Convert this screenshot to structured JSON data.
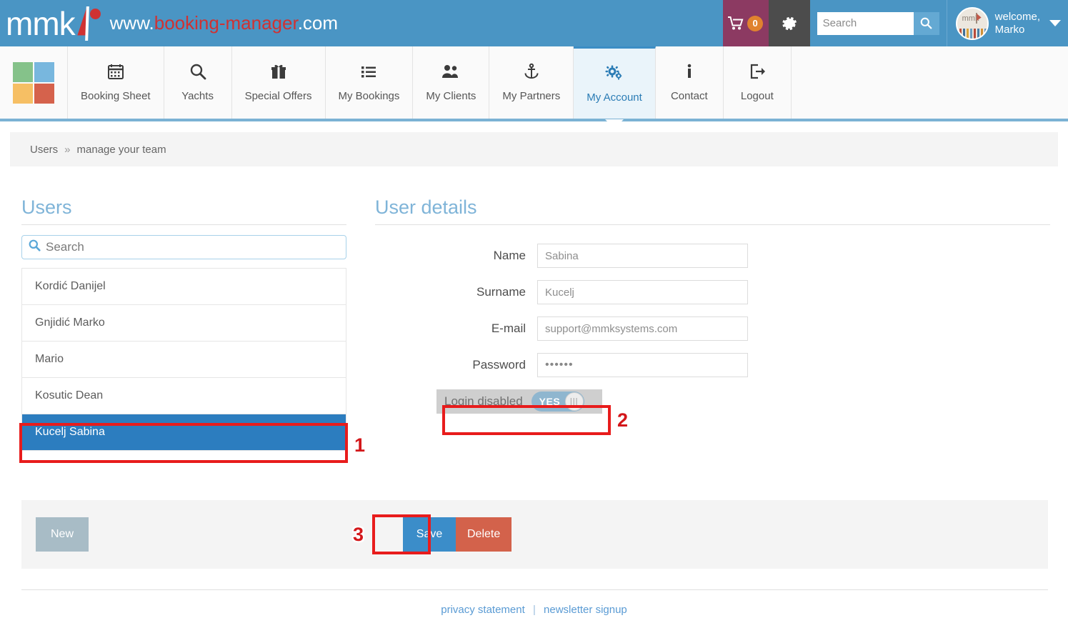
{
  "header": {
    "logo_text": "mmk",
    "site_url_prefix": "www.",
    "site_url_brand": "booking-manager",
    "site_url_suffix": ".com",
    "cart_icon": "shopping-cart-icon",
    "cart_count": "0",
    "gear_icon": "gear-icon",
    "search": {
      "placeholder": "Search",
      "value": "",
      "button_icon": "search-icon"
    },
    "avatar_label": "mmk",
    "welcome_line1": "welcome,",
    "welcome_line2": "Marko",
    "dropdown_icon": "chevron-down-icon",
    "colors": {
      "bar": "#4a95c4",
      "cart": "#8c3a62",
      "badge": "#e0822f",
      "gear": "#4c4c4c",
      "brand_red": "#cf3233"
    }
  },
  "nav": {
    "logo_squares": [
      "#85c28a",
      "#78b7de",
      "#f6bf64",
      "#d5624c"
    ],
    "items": [
      {
        "label": "Booking Sheet",
        "icon": "calendar-icon",
        "glyph": "☷",
        "active": false
      },
      {
        "label": "Yachts",
        "icon": "search-icon",
        "glyph": "⚲",
        "active": false
      },
      {
        "label": "Special Offers",
        "icon": "gift-icon",
        "glyph": "Ἰ1",
        "active": false
      },
      {
        "label": "My Bookings",
        "icon": "list-icon",
        "glyph": "☰",
        "active": false
      },
      {
        "label": "My Clients",
        "icon": "users-icon",
        "glyph": "὆5",
        "active": false
      },
      {
        "label": "My Partners",
        "icon": "anchor-icon",
        "glyph": "⚓",
        "active": false
      },
      {
        "label": "My Account",
        "icon": "gears-icon",
        "glyph": "⚙",
        "active": true
      },
      {
        "label": "Contact",
        "icon": "info-icon",
        "glyph": "i",
        "active": false
      },
      {
        "label": "Logout",
        "icon": "logout-icon",
        "glyph": "↪",
        "active": false
      }
    ]
  },
  "breadcrumb": {
    "first": "Users",
    "separator": "»",
    "second": "manage your team"
  },
  "users_panel": {
    "title": "Users",
    "search_placeholder": "Search",
    "search_value": "",
    "search_icon": "search-icon",
    "items": [
      {
        "name": "Kordić Danijel",
        "selected": false
      },
      {
        "name": "Gnjidić Marko",
        "selected": false
      },
      {
        "name": "Mario",
        "selected": false
      },
      {
        "name": "Kosutic Dean",
        "selected": false
      },
      {
        "name": "Kucelj Sabina",
        "selected": true
      }
    ]
  },
  "details_panel": {
    "title": "User details",
    "fields": [
      {
        "label": "Name",
        "value": "Sabina"
      },
      {
        "label": "Surname",
        "value": "Kucelj"
      },
      {
        "label": "E-mail",
        "value": "support@mmksystems.com"
      },
      {
        "label": "Password",
        "value": "••••••"
      }
    ],
    "toggle": {
      "label": "Login disabled",
      "state_text": "YES",
      "knob_glyph": "|||"
    }
  },
  "actions": {
    "new_label": "New",
    "save_label": "Save",
    "delete_label": "Delete"
  },
  "footer": {
    "privacy": "privacy statement",
    "divider": "|",
    "newsletter": "newsletter signup"
  },
  "annotations": [
    {
      "number": "1",
      "target": "selected-user-row"
    },
    {
      "number": "2",
      "target": "login-disabled-toggle"
    },
    {
      "number": "3",
      "target": "save-button"
    }
  ]
}
